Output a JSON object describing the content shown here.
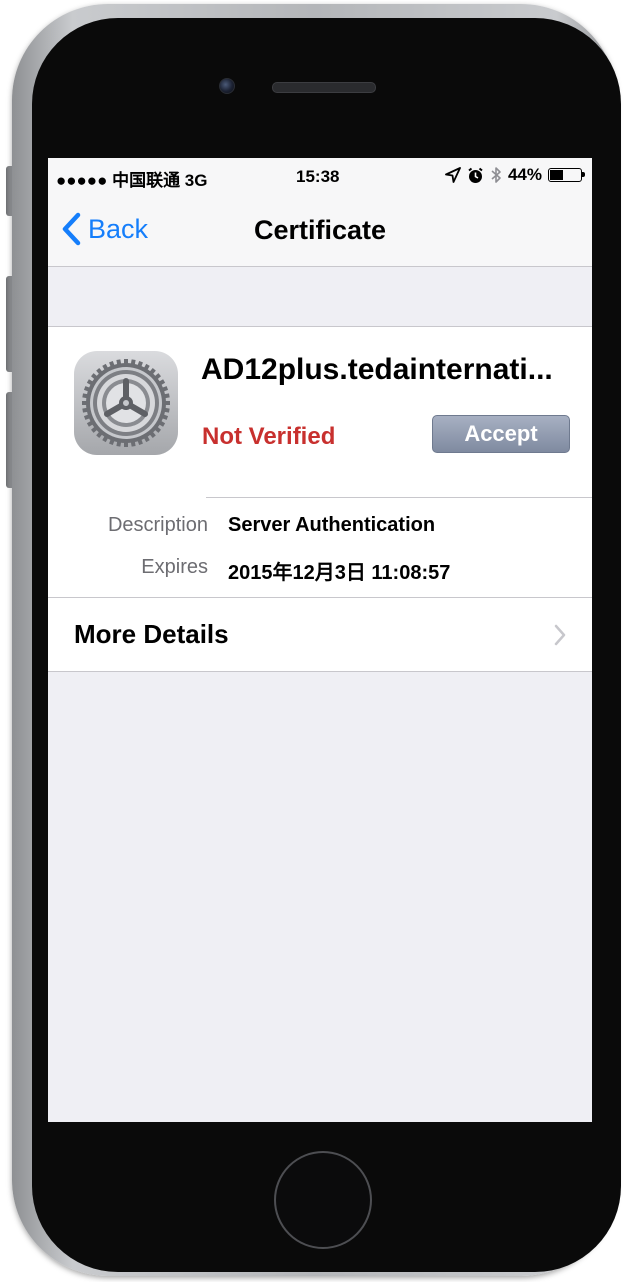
{
  "status_bar": {
    "carrier": "●●●●● 中国联通 3G",
    "time": "15:38",
    "battery_percent": "44%",
    "battery_level": 0.44,
    "icons": [
      "location-icon",
      "alarm-icon",
      "bluetooth-icon",
      "battery-icon"
    ]
  },
  "nav": {
    "back_label": "Back",
    "title": "Certificate"
  },
  "certificate": {
    "name": "AD12plus.tedainternati...",
    "status": "Not Verified",
    "accept_label": "Accept",
    "icon": "settings-gear-icon",
    "details": [
      {
        "label": "Description",
        "value": "Server Authentication"
      },
      {
        "label": "Expires",
        "value": "2015年12月3日 11:08:57"
      }
    ]
  },
  "more_details": {
    "label": "More Details"
  },
  "colors": {
    "ios_blue": "#157efb",
    "not_verified_red": "#c8302e",
    "accept_button": "#8b95aa",
    "grouped_background": "#efeff4"
  }
}
